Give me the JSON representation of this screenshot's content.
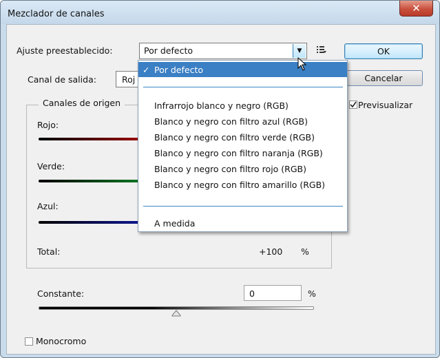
{
  "window": {
    "title": "Mezclador de canales",
    "close_glyph": "✕"
  },
  "preset": {
    "label": "Ajuste preestablecido:",
    "value": "Por defecto",
    "arrow_glyph": "▼",
    "options_icon": "preset-options-icon"
  },
  "buttons": {
    "ok": "OK",
    "cancel": "Cancelar"
  },
  "output": {
    "label": "Canal de salida:",
    "value": "Roj"
  },
  "preview": {
    "label": "Previsualizar",
    "checked": true
  },
  "source": {
    "legend": "Canales de origen",
    "channels": [
      {
        "label": "Rojo:",
        "color": "#d01010"
      },
      {
        "label": "Verde:",
        "color": "#10a030"
      },
      {
        "label": "Azul:",
        "color": "#1420c0"
      }
    ],
    "total_label": "Total:",
    "total_value": "+100",
    "total_unit": "%"
  },
  "constant": {
    "label": "Constante:",
    "value": "0",
    "unit": "%",
    "slider_level": 0.5
  },
  "monochrome": {
    "label": "Monocromo",
    "checked": false
  },
  "menu": {
    "selected": "Por defecto",
    "check_glyph": "✓",
    "items": [
      "Infrarrojo blanco y negro (RGB)",
      "Blanco y negro con filtro azul (RGB)",
      "Blanco y negro con filtro verde (RGB)",
      "Blanco y negro con filtro naranja (RGB)",
      "Blanco y negro con filtro rojo (RGB)",
      "Blanco y negro con filtro amarillo (RGB)"
    ],
    "custom": "A medida"
  },
  "colors": {
    "accent": "#3b7fc4",
    "separator": "#3a87c5"
  }
}
